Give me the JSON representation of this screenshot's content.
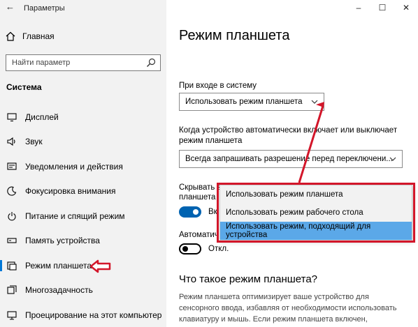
{
  "window": {
    "title": "Параметры",
    "controls": [
      "–",
      "☐",
      "✕"
    ]
  },
  "sidebar": {
    "home_label": "Главная",
    "search_placeholder": "Найти параметр",
    "section_title": "Система",
    "items": [
      {
        "label": "Дисплей",
        "icon": "display-icon"
      },
      {
        "label": "Звук",
        "icon": "sound-icon"
      },
      {
        "label": "Уведомления и действия",
        "icon": "notifications-icon"
      },
      {
        "label": "Фокусировка внимания",
        "icon": "focus-assist-icon"
      },
      {
        "label": "Питание и спящий режим",
        "icon": "power-icon"
      },
      {
        "label": "Память устройства",
        "icon": "storage-icon"
      },
      {
        "label": "Режим планшета",
        "icon": "tablet-mode-icon",
        "active": true
      },
      {
        "label": "Многозадачность",
        "icon": "multitasking-icon"
      },
      {
        "label": "Проецирование на этот компьютер",
        "icon": "projecting-icon"
      }
    ]
  },
  "main": {
    "title": "Режим планшета",
    "signin_label": "При входе в систему",
    "signin_value": "Использовать режим планшета",
    "auto_switch_label": "Когда устройство автоматически включает или выключает режим планшета",
    "auto_switch_value": "Всегда запрашивать разрешение перед переключени...",
    "hide_icons_label_visible": "Скрывать з",
    "hide_icons_label_line2": "планшета",
    "hide_icons_toggle_text": "Вк",
    "hide_icons_toggle_on": true,
    "auto_hide_label_visible": "Автоматич",
    "auto_hide_toggle_text": "Откл.",
    "auto_hide_toggle_on": false,
    "whatis_title": "Что такое режим планшета?",
    "whatis_text": "Режим планшета оптимизирует ваше устройство для сенсорного ввода, избавляя от необходимости использовать клавиатуру и мышь. Если режим планшета включен, приложения запускаются в полноэкранном режиме, а"
  },
  "popup": {
    "options": [
      "Использовать режим планшета",
      "Использовать режим рабочего стола",
      "Использовать режим, подходящий для устройства"
    ],
    "selected_index": 2
  },
  "colors": {
    "accent": "#0078d7",
    "annotation_red": "#d3162a",
    "selected_bg": "#5ba8e8"
  }
}
